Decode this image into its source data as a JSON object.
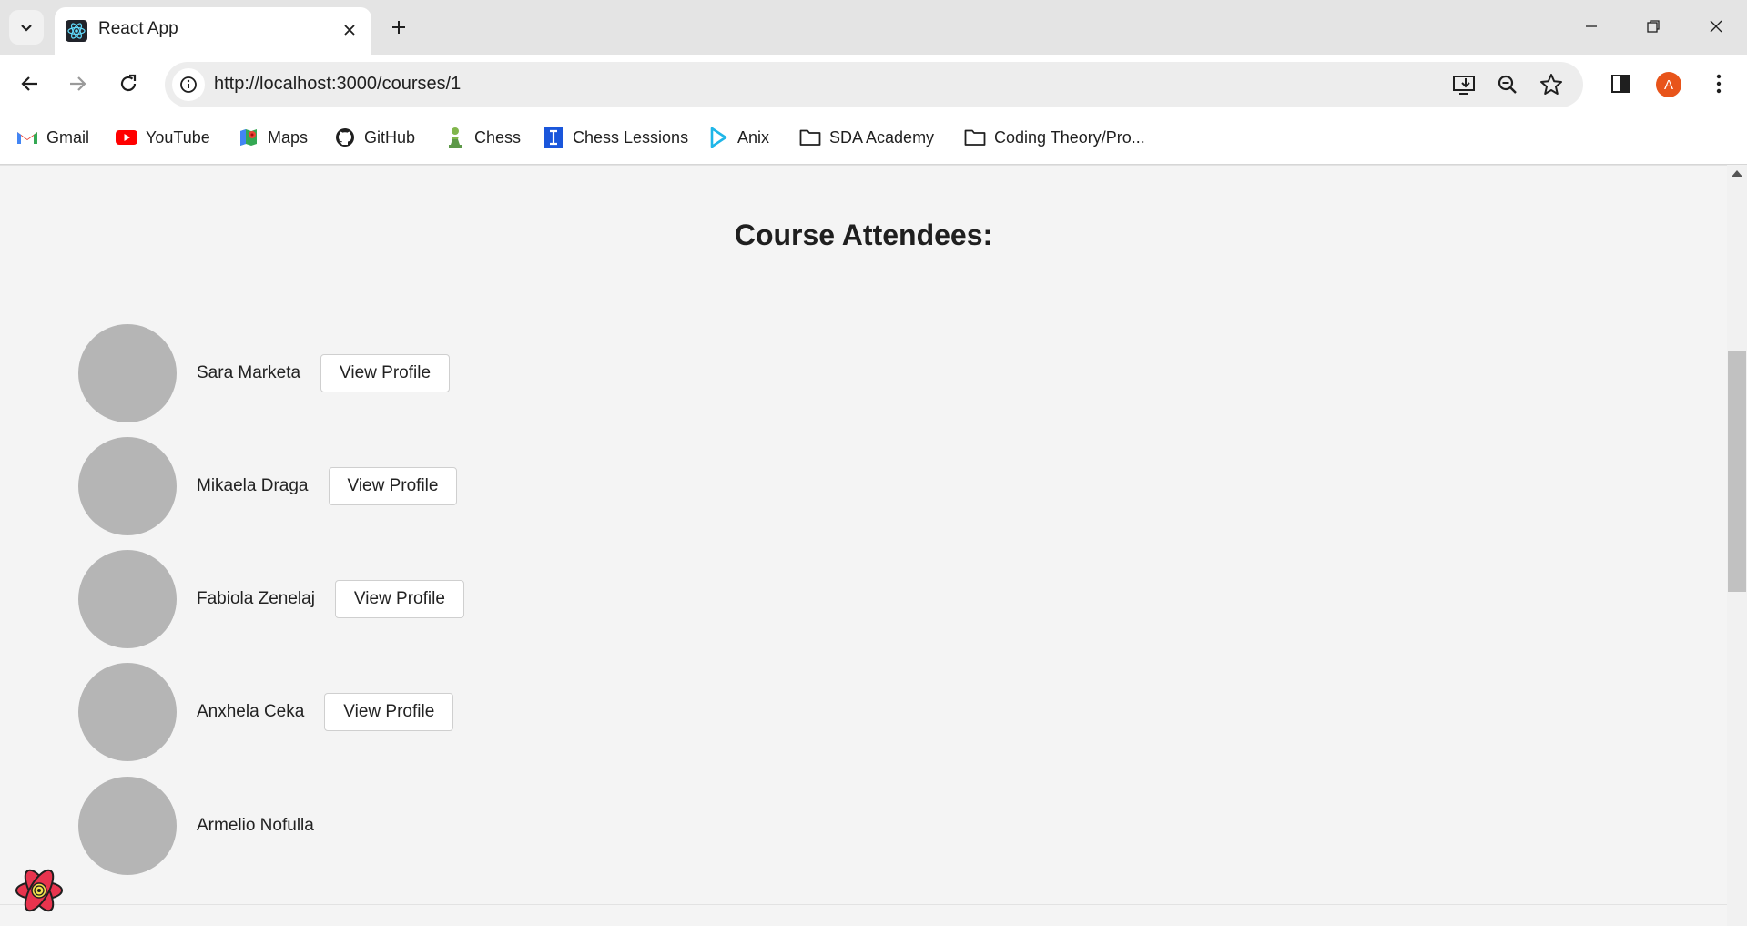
{
  "browser": {
    "tab_title": "React App",
    "url": "http://localhost:3000/courses/1",
    "profile_initial": "A",
    "bookmarks": [
      {
        "label": "Gmail",
        "icon": "gmail-icon"
      },
      {
        "label": "YouTube",
        "icon": "youtube-icon"
      },
      {
        "label": "Maps",
        "icon": "maps-icon"
      },
      {
        "label": "GitHub",
        "icon": "github-icon"
      },
      {
        "label": "Chess",
        "icon": "chess-pawn-icon"
      },
      {
        "label": "Chess Lessions",
        "icon": "chess-lessons-icon"
      },
      {
        "label": "Anix",
        "icon": "anix-play-icon"
      },
      {
        "label": "SDA Academy",
        "icon": "folder-icon"
      },
      {
        "label": "Coding Theory/Pro...",
        "icon": "folder-icon"
      }
    ],
    "colors": {
      "accent_profile": "#e8541a",
      "tabstrip": "#e4e4e4"
    }
  },
  "page": {
    "title": "Course Attendees:",
    "attendees": [
      {
        "name": "Sara Marketa",
        "button": "View Profile"
      },
      {
        "name": "Mikaela Draga",
        "button": "View Profile"
      },
      {
        "name": "Fabiola Zenelaj",
        "button": "View Profile"
      },
      {
        "name": "Anxhela Ceka",
        "button": "View Profile"
      },
      {
        "name": "Armelio Nofulla",
        "button": ""
      }
    ]
  }
}
